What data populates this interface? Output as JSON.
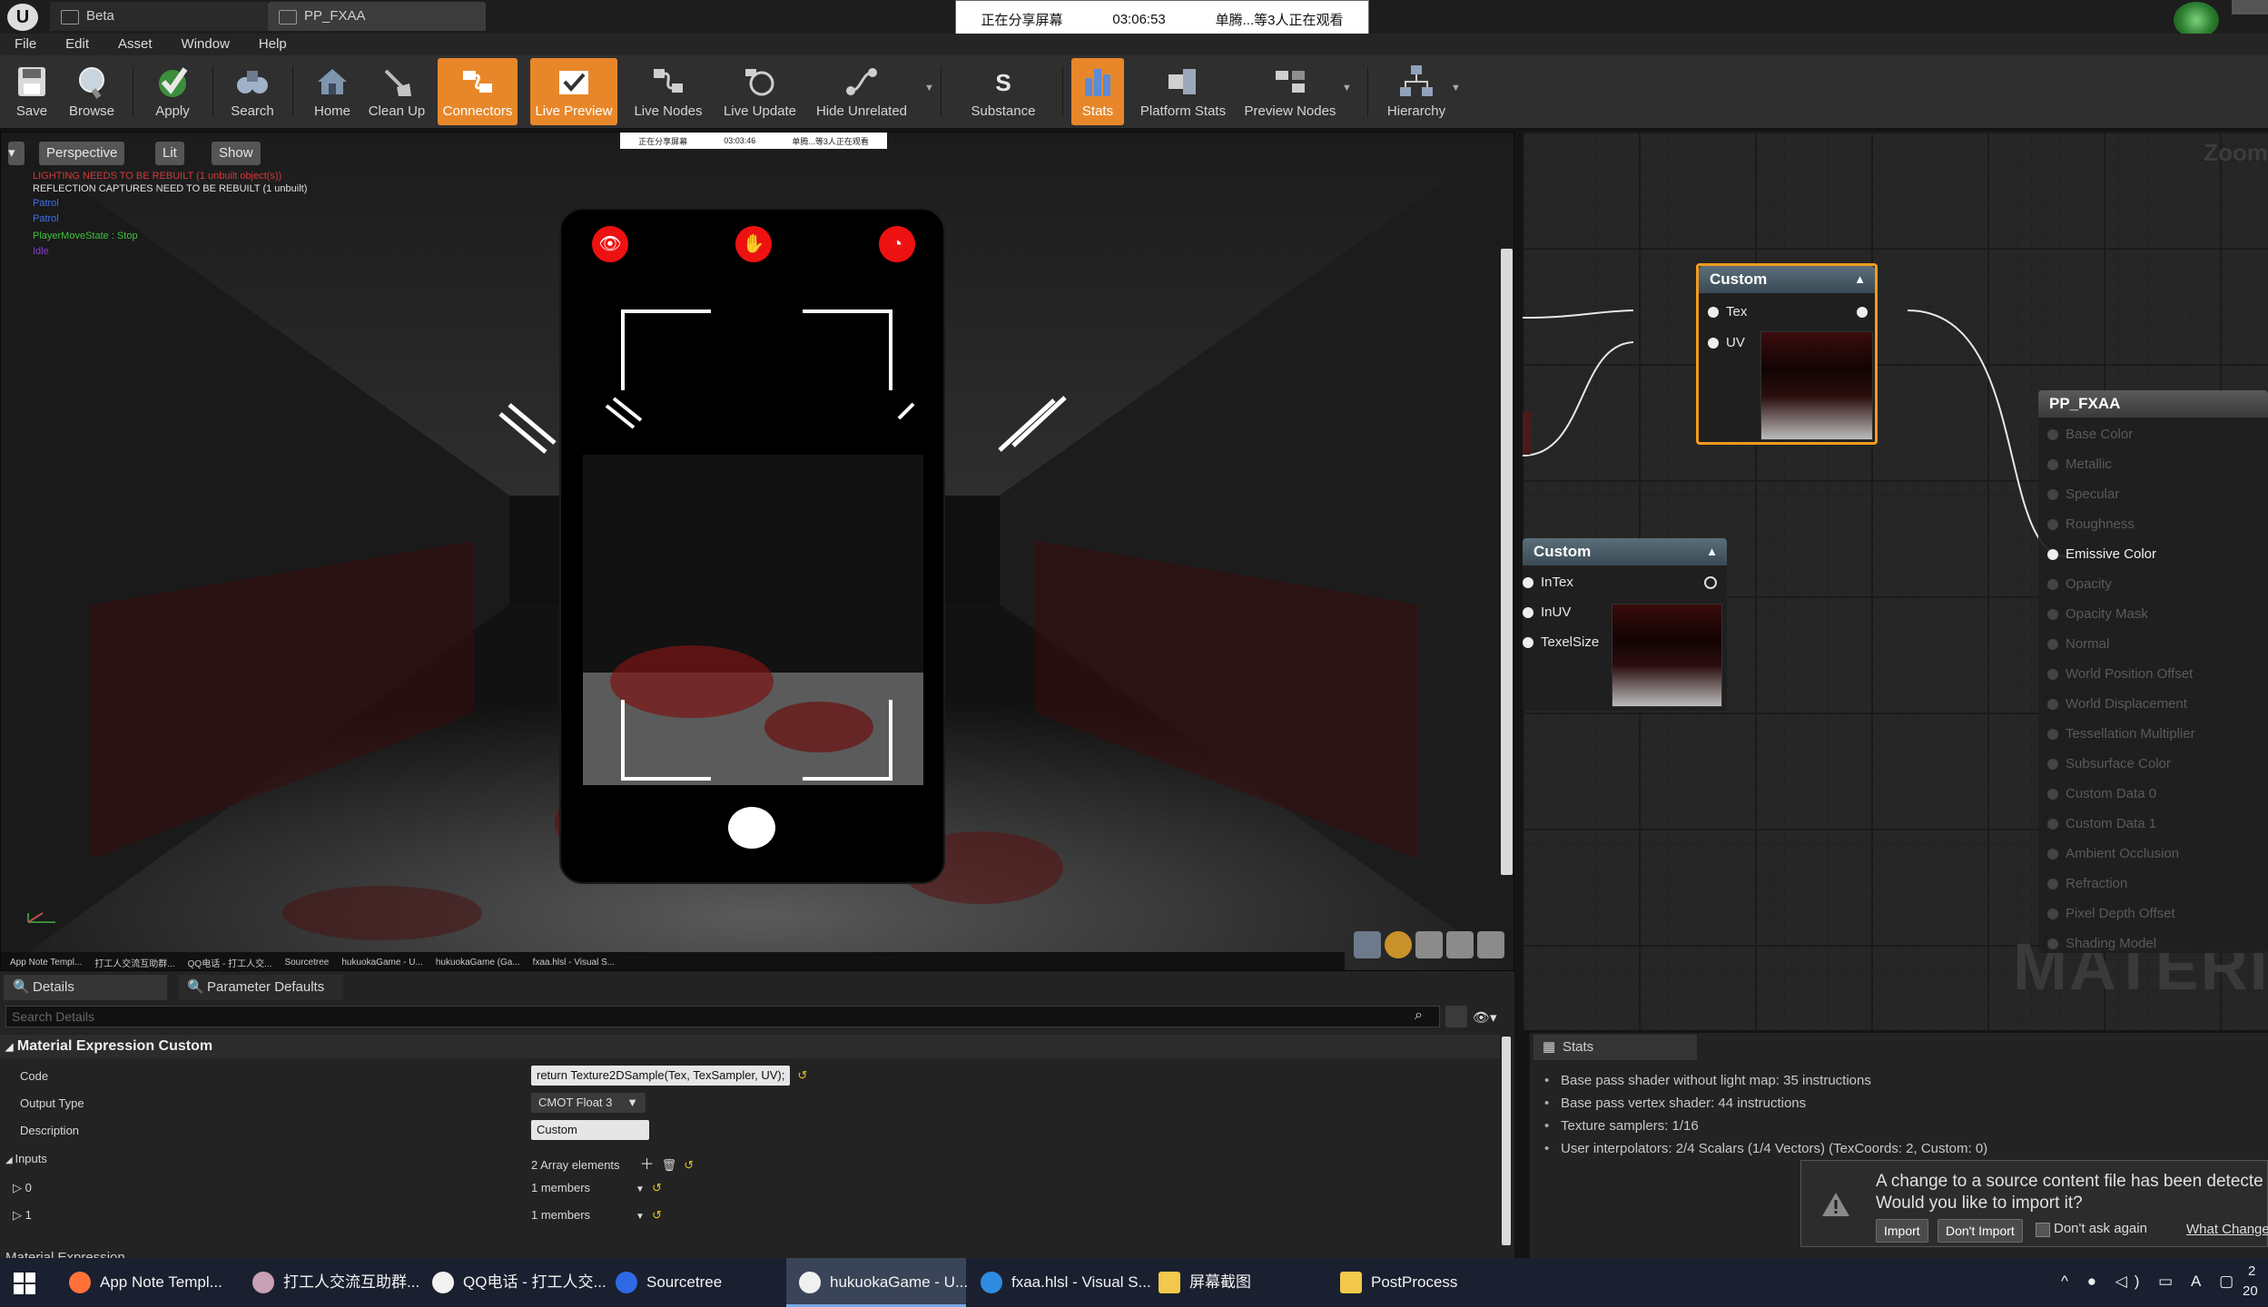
{
  "title_bar": {
    "logo": "U",
    "tabs": [
      "Beta",
      "PP_FXAA"
    ],
    "share_banner": {
      "status": "正在分享屏幕",
      "time": "03:06:53",
      "viewers": "单腾...等3人正在观看"
    }
  },
  "menu": [
    "File",
    "Edit",
    "Asset",
    "Window",
    "Help"
  ],
  "toolbar": {
    "buttons": [
      {
        "label": "Save",
        "icon": "save-icon",
        "active": false
      },
      {
        "label": "Browse",
        "icon": "browse-icon",
        "active": false
      },
      {
        "label": "Apply",
        "icon": "apply-check-icon",
        "active": false
      },
      {
        "label": "Search",
        "icon": "search-binoculars-icon",
        "active": false
      },
      {
        "label": "Home",
        "icon": "home-icon",
        "active": false
      },
      {
        "label": "Clean Up",
        "icon": "broom-icon",
        "active": false
      },
      {
        "label": "Connectors",
        "icon": "connectors-icon",
        "active": true
      },
      {
        "label": "Live Preview",
        "icon": "live-preview-icon",
        "active": true
      },
      {
        "label": "Live Nodes",
        "icon": "live-nodes-icon",
        "active": false
      },
      {
        "label": "Live Update",
        "icon": "live-update-icon",
        "active": false
      },
      {
        "label": "Hide Unrelated",
        "icon": "hide-unrelated-icon",
        "active": false
      },
      {
        "label": "Substance",
        "icon": "substance-icon",
        "active": false
      },
      {
        "label": "Stats",
        "icon": "stats-icon",
        "active": true
      },
      {
        "label": "Platform Stats",
        "icon": "platform-stats-icon",
        "active": false
      },
      {
        "label": "Preview Nodes",
        "icon": "preview-nodes-icon",
        "active": false
      },
      {
        "label": "Hierarchy",
        "icon": "hierarchy-icon",
        "active": false
      }
    ]
  },
  "viewport": {
    "perspective": "Perspective",
    "lit": "Lit",
    "show": "Show",
    "messages": [
      {
        "text": "LIGHTING NEEDS TO BE REBUILT (1 unbuilt object(s))",
        "color": "#d23a3a"
      },
      {
        "text": "REFLECTION CAPTURES NEED TO BE REBUILT (1 unbuilt)",
        "color": "#e0e0e0"
      },
      {
        "text": "Patrol",
        "color": "#3f6ee8"
      },
      {
        "text": "Patrol",
        "color": "#3f6ee8"
      },
      {
        "text": "PlayerMoveState : Stop",
        "color": "#3ac43a"
      },
      {
        "text": "Idle",
        "color": "#8a3ad2"
      }
    ],
    "mini_banner": {
      "status": "正在分享屏幕",
      "time": "03:03:46",
      "viewers": "单腾...等3人正在观看"
    },
    "mini_taskbar": [
      "App Note Templ...",
      "打工人交流互助群...",
      "QQ电话 - 打工人交...",
      "Sourcetree",
      "hukuokaGame - U...",
      "hukuokaGame (Ga...",
      "fxaa.hlsl - Visual S..."
    ],
    "axis_labels": {
      "z": "z",
      "x": "x"
    },
    "phone_icons": [
      "eye-icon",
      "hand-icon",
      "ear-icon"
    ]
  },
  "graph": {
    "zoom": "Zoom",
    "watermark": "MATERIAL",
    "nodes": [
      {
        "id": "custom_top",
        "title": "Custom",
        "inputs": [
          "Tex",
          "UV"
        ],
        "selected": true
      },
      {
        "id": "custom_bottom",
        "title": "Custom",
        "inputs": [
          "InTex",
          "InUV",
          "TexelSize"
        ],
        "selected": false
      },
      {
        "id": "pp_fxaa",
        "title": "PP_FXAA",
        "inputs": [
          "Base Color",
          "Metallic",
          "Specular",
          "Roughness",
          "Emissive Color",
          "Opacity",
          "Opacity Mask",
          "Normal",
          "World Position Offset",
          "World Displacement",
          "Tessellation Multiplier",
          "Subsurface Color",
          "Custom Data 0",
          "Custom Data 1",
          "Ambient Occlusion",
          "Refraction",
          "Pixel Depth Offset",
          "Shading Model"
        ],
        "active_input": "Emissive Color"
      }
    ]
  },
  "details": {
    "tabs": [
      "Details",
      "Parameter Defaults"
    ],
    "search_placeholder": "Search Details",
    "section": "Material Expression Custom",
    "rows": {
      "code": {
        "name": "Code",
        "value": "return Texture2DSample(Tex, TexSampler, UV);"
      },
      "output_type": {
        "name": "Output Type",
        "value": "CMOT Float 3"
      },
      "description": {
        "name": "Description",
        "value": "Custom"
      },
      "inputs": {
        "name": "Inputs",
        "value": "2 Array elements"
      },
      "input_0": {
        "name": "0",
        "value": "1 members"
      },
      "input_1": {
        "name": "1",
        "value": "1 members"
      }
    },
    "next_section": "Material Expression"
  },
  "stats": {
    "tab": "Stats",
    "lines": [
      "Base pass shader without light map: 35 instructions",
      "Base pass vertex shader: 44 instructions",
      "Texture samplers: 1/16",
      "User interpolators: 2/4 Scalars (1/4 Vectors) (TexCoords: 2, Custom: 0)"
    ]
  },
  "import_popup": {
    "message_line1": "A change to a source content file has been detecte",
    "message_line2": "Would you like to import it?",
    "import": "Import",
    "dont_import": "Don't Import",
    "dont_ask": "Don't ask again",
    "whats_changed": "What Change"
  },
  "taskbar": {
    "items": [
      {
        "label": "App Note Templ...",
        "icon": "firefox-icon",
        "color": "#ff7139"
      },
      {
        "label": "打工人交流互助群...",
        "icon": "avatar-icon",
        "color": "#c9a0b4"
      },
      {
        "label": "QQ电话 - 打工人交...",
        "icon": "qq-icon",
        "color": "#f2f2f2"
      },
      {
        "label": "Sourcetree",
        "icon": "sourcetree-icon",
        "color": "#2f6ae6"
      },
      {
        "label": "hukuokaGame - U...",
        "icon": "unreal-icon",
        "color": "#f0f0f0",
        "active": true
      },
      {
        "label": "fxaa.hlsl - Visual S...",
        "icon": "vscode-icon",
        "color": "#2f8be0"
      },
      {
        "label": "屏幕截图",
        "icon": "folder-icon",
        "color": "#f2c94c"
      },
      {
        "label": "PostProcess",
        "icon": "folder-icon",
        "color": "#f2c94c"
      }
    ],
    "tray_text": "A",
    "clock_fragment": "2",
    "clock_fragment2": "20"
  },
  "colors": {
    "accent_orange": "#e8872a",
    "node_selected_border": "#f29b1d",
    "panel_bg": "#232323",
    "graph_bg": "#262626"
  }
}
